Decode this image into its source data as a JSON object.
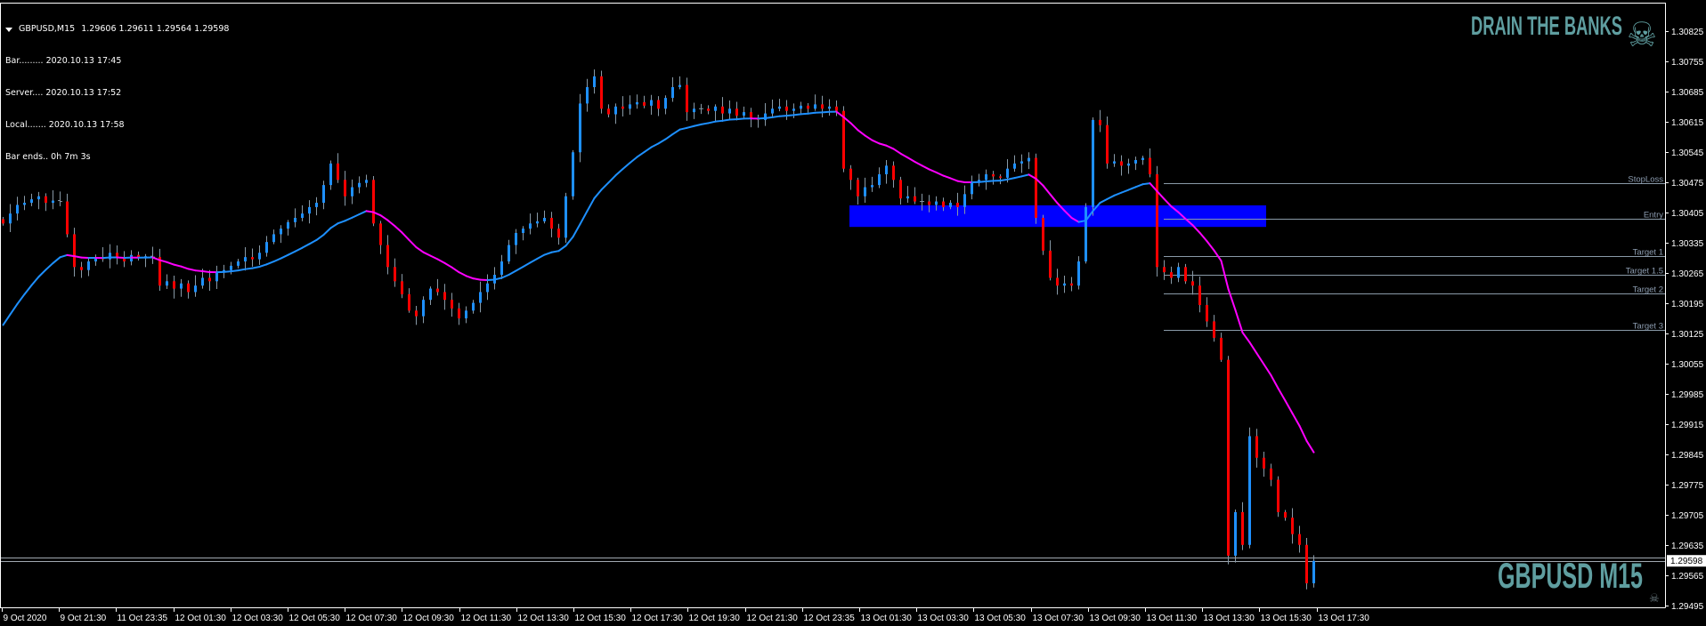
{
  "header": {
    "symbol": "GBPUSD,M15",
    "ohlc": "1.29606 1.29611 1.29564 1.29598",
    "info_lines": [
      "Bar......... 2020.10.13 17:45",
      "Server.... 2020.10.13 17:52",
      "Local....... 2020.10.13 17:58",
      "Bar ends.. 0h 7m 3s"
    ]
  },
  "branding": {
    "logo_text": "DRAIN THE BANKS",
    "logo_icon": "skull-crossbones-icon",
    "watermark": "GBPUSD M15",
    "corner_icon": "skull-crossbones-icon"
  },
  "colors": {
    "background": "#000000",
    "bull_body": "#1e90ff",
    "bear_body": "#ff0000",
    "wick": "#8899a6",
    "ma_rising": "#1e90ff",
    "ma_falling": "#ff00ff",
    "entry_zone": "#0000ff",
    "level_line": "#8a9aa8",
    "branding": "#5f9ea0",
    "axis": "#ffffff"
  },
  "chart_data": {
    "type": "candlestick",
    "symbol": "GBPUSD",
    "timeframe": "M15",
    "ylim": [
      1.2948,
      1.309
    ],
    "grid": false,
    "closes": [
      1.3038,
      1.30403,
      1.30423,
      1.30428,
      1.30436,
      1.30443,
      1.30428,
      1.30433,
      1.30431,
      1.30355,
      1.30279,
      1.30272,
      1.30292,
      1.30302,
      1.30297,
      1.30312,
      1.30302,
      1.30292,
      1.30307,
      1.30299,
      1.30304,
      1.30302,
      1.30236,
      1.30246,
      1.30229,
      1.30241,
      1.30221,
      1.30236,
      1.30254,
      1.30246,
      1.30267,
      1.30272,
      1.30282,
      1.30292,
      1.30302,
      1.30297,
      1.30312,
      1.30337,
      1.30355,
      1.30368,
      1.30383,
      1.30393,
      1.30403,
      1.30418,
      1.30428,
      1.30469,
      1.30519,
      1.30481,
      1.30443,
      1.30464,
      1.30474,
      1.30481,
      1.3038,
      1.3033,
      1.30279,
      1.30246,
      1.30216,
      1.30178,
      1.30165,
      1.30203,
      1.30229,
      1.30221,
      1.30203,
      1.30183,
      1.3016,
      1.30178,
      1.30196,
      1.30221,
      1.30241,
      1.30261,
      1.30292,
      1.3033,
      1.30358,
      1.30368,
      1.3038,
      1.30385,
      1.30393,
      1.30368,
      1.30347,
      1.30443,
      1.30545,
      1.30658,
      1.30696,
      1.30721,
      1.30646,
      1.30633,
      1.30651,
      1.30646,
      1.30656,
      1.30661,
      1.30653,
      1.30666,
      1.30646,
      1.30671,
      1.30696,
      1.30701,
      1.30638,
      1.30646,
      1.30646,
      1.30641,
      1.30651,
      1.30635,
      1.30646,
      1.3063,
      1.30638,
      1.30625,
      1.3062,
      1.30635,
      1.30646,
      1.30651,
      1.30641,
      1.30646,
      1.30653,
      1.30646,
      1.30656,
      1.30646,
      1.30651,
      1.30641,
      1.30507,
      1.30481,
      1.30443,
      1.30464,
      1.30469,
      1.30494,
      1.30514,
      1.30481,
      1.30438,
      1.30443,
      1.30431,
      1.30431,
      1.30423,
      1.30431,
      1.30418,
      1.30428,
      1.30418,
      1.30448,
      1.30474,
      1.30481,
      1.30494,
      1.30489,
      1.30486,
      1.30507,
      1.30519,
      1.30524,
      1.30532,
      1.30393,
      1.30317,
      1.30254,
      1.30236,
      1.30241,
      1.30236,
      1.30292,
      1.30418,
      1.3062,
      1.30608,
      1.30519,
      1.30524,
      1.30514,
      1.30519,
      1.30527,
      1.30532,
      1.30494,
      1.30279,
      1.30267,
      1.30254,
      1.30279,
      1.30246,
      1.30236,
      1.30191,
      1.30153,
      1.30115,
      1.30064,
      1.2961,
      1.29711,
      1.29635,
      1.29887,
      1.29837,
      1.29812,
      1.29786,
      1.29711,
      1.29698,
      1.2966,
      1.29635,
      1.29546,
      1.29598
    ],
    "price_ticks": [
      "1.30825",
      "1.30755",
      "1.30685",
      "1.30615",
      "1.30545",
      "1.30475",
      "1.30405",
      "1.30335",
      "1.30265",
      "1.30195",
      "1.30125",
      "1.30055",
      "1.29985",
      "1.29915",
      "1.29845",
      "1.29775",
      "1.29705",
      "1.29635",
      "1.29565",
      "1.29495"
    ],
    "time_labels": [
      "9 Oct 2020",
      "9 Oct 21:30",
      "11 Oct 23:35",
      "12 Oct 01:30",
      "12 Oct 03:30",
      "12 Oct 05:30",
      "12 Oct 07:30",
      "12 Oct 09:30",
      "12 Oct 11:30",
      "12 Oct 13:30",
      "12 Oct 15:30",
      "12 Oct 17:30",
      "12 Oct 19:30",
      "12 Oct 21:30",
      "12 Oct 23:35",
      "13 Oct 01:30",
      "13 Oct 03:30",
      "13 Oct 05:30",
      "13 Oct 07:30",
      "13 Oct 09:30",
      "13 Oct 11:30",
      "13 Oct 13:30",
      "13 Oct 15:30",
      "13 Oct 17:30"
    ],
    "levels": [
      {
        "label": "StopLoss",
        "price": 1.30474
      },
      {
        "label": "Entry",
        "price": 1.3039
      },
      {
        "label": "Target 1",
        "price": 1.30305
      },
      {
        "label": "Target 1.5",
        "price": 1.30262
      },
      {
        "label": "Target 2",
        "price": 1.30218
      },
      {
        "label": "Target 3",
        "price": 1.30134
      }
    ],
    "levels_start_bar": 163,
    "entry_zone": {
      "top": 1.30422,
      "bottom": 1.30372,
      "start_bar": 119,
      "end_bar": 177
    },
    "current_price": {
      "bid": 1.29598,
      "bid_label": "1.29598",
      "ask": 1.29606
    }
  }
}
